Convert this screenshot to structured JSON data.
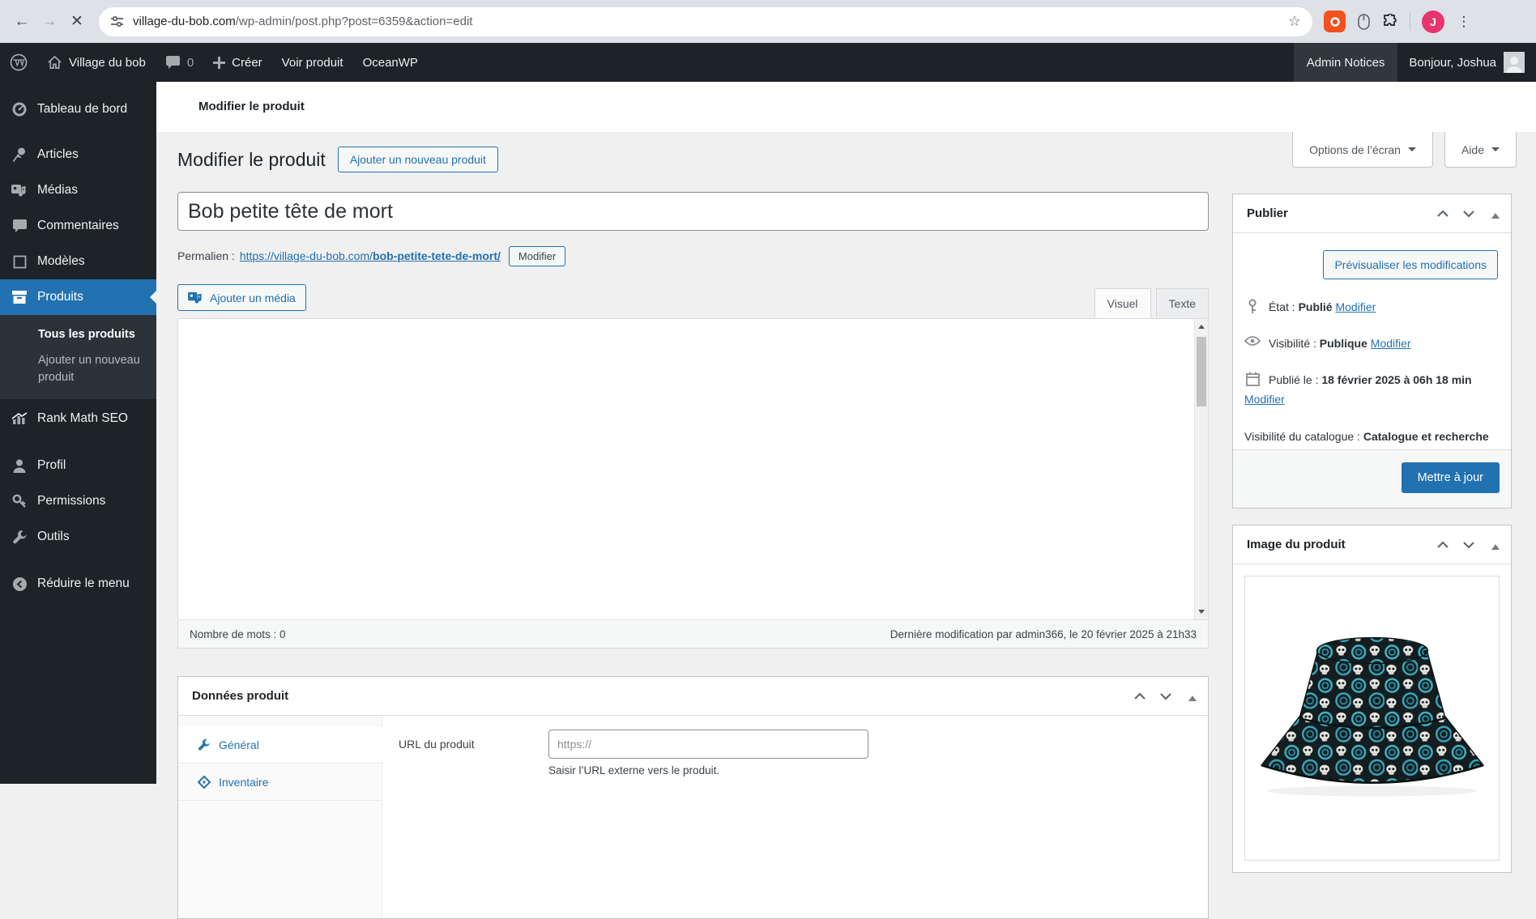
{
  "browser": {
    "url_domain": "village-du-bob.com",
    "url_path": "/wp-admin/post.php?post=6359&action=edit",
    "profile_initial": "J"
  },
  "admin_bar": {
    "site_name": "Village du bob",
    "comments_count": "0",
    "create_label": "Créer",
    "view_product_label": "Voir produit",
    "theme_label": "OceanWP",
    "notices_label": "Admin Notices",
    "greeting": "Bonjour, Joshua"
  },
  "sidebar": {
    "items": [
      {
        "label": "Tableau de bord"
      },
      {
        "label": "Articles"
      },
      {
        "label": "Médias"
      },
      {
        "label": "Commentaires"
      },
      {
        "label": "Modèles"
      },
      {
        "label": "Produits"
      },
      {
        "label": "Rank Math SEO"
      },
      {
        "label": "Profil"
      },
      {
        "label": "Permissions"
      },
      {
        "label": "Outils"
      },
      {
        "label": "Réduire le menu"
      }
    ],
    "submenu": [
      {
        "label": "Tous les produits"
      },
      {
        "label": "Ajouter un nouveau produit"
      }
    ]
  },
  "header_strip": {
    "title": "Modifier le produit"
  },
  "screen_controls": {
    "options_label": "Options de l’écran",
    "help_label": "Aide"
  },
  "page": {
    "heading": "Modifier le produit",
    "add_new_label": "Ajouter un nouveau produit",
    "product_title": "Bob petite tête de mort",
    "permalink_label": "Permalien :",
    "permalink_base": "https://village-du-bob.com/",
    "permalink_slug": "bob-petite-tete-de-mort/",
    "edit_slug_label": "Modifier"
  },
  "editor": {
    "add_media_label": "Ajouter un média",
    "visual_tab": "Visuel",
    "text_tab": "Texte",
    "word_count": "Nombre de mots : 0",
    "last_modified": "Dernière modification par admin366, le 20 février 2025 à 21h33"
  },
  "product_data": {
    "title": "Données produit",
    "tabs": [
      {
        "label": "Général"
      },
      {
        "label": "Inventaire"
      }
    ],
    "url_field_label": "URL du produit",
    "url_placeholder": "https://",
    "url_help": "Saisir l’URL externe vers le produit."
  },
  "publish": {
    "title": "Publier",
    "preview_label": "Prévisualiser les modifications",
    "status_label": "État :",
    "status_value": "Publié",
    "visibility_label": "Visibilité :",
    "visibility_value": "Publique",
    "published_label": "Publié le :",
    "published_value": "18 février 2025 à 06h 18 min",
    "catalog_label": "Visibilité du catalogue :",
    "catalog_value": "Catalogue et recherche",
    "modify_label": "Modifier",
    "update_label": "Mettre à jour"
  },
  "product_image": {
    "title": "Image du produit"
  },
  "colors": {
    "accent": "#2271b1",
    "sidebar_bg": "#1d2327",
    "update_button": "#2271b1"
  }
}
